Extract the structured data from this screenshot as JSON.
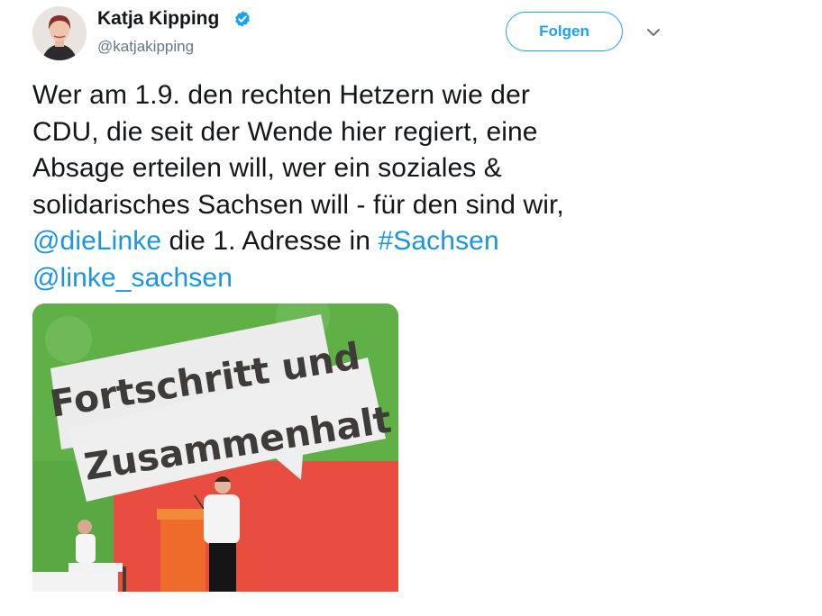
{
  "author": {
    "name": "Katja Kipping",
    "handle": "@katjakipping",
    "verified": true
  },
  "actions": {
    "follow_label": "Folgen",
    "more_icon": "chevron-down-icon"
  },
  "tweet": {
    "line1": "Wer am 1.9. den rechten Hetzern wie der",
    "line2": "CDU, die seit der Wende hier regiert, eine",
    "line3": "Absage erteilen will, wer ein soziales &",
    "line4": "solidarisches Sachsen will - für den sind wir,",
    "mention1": "@dieLinke",
    "line5_middle": " die 1. Adresse in ",
    "hashtag": "#Sachsen",
    "mention2": "@linke_sachsen"
  },
  "media": {
    "banner_line1": "Fortschritt und",
    "banner_line2": "Zusammenhalt"
  },
  "colors": {
    "accent": "#1da1f2",
    "link": "#1b95e0",
    "verified": "#1da1f2",
    "backdrop_red": "#e84a3c",
    "backdrop_green": "#5daf47"
  }
}
